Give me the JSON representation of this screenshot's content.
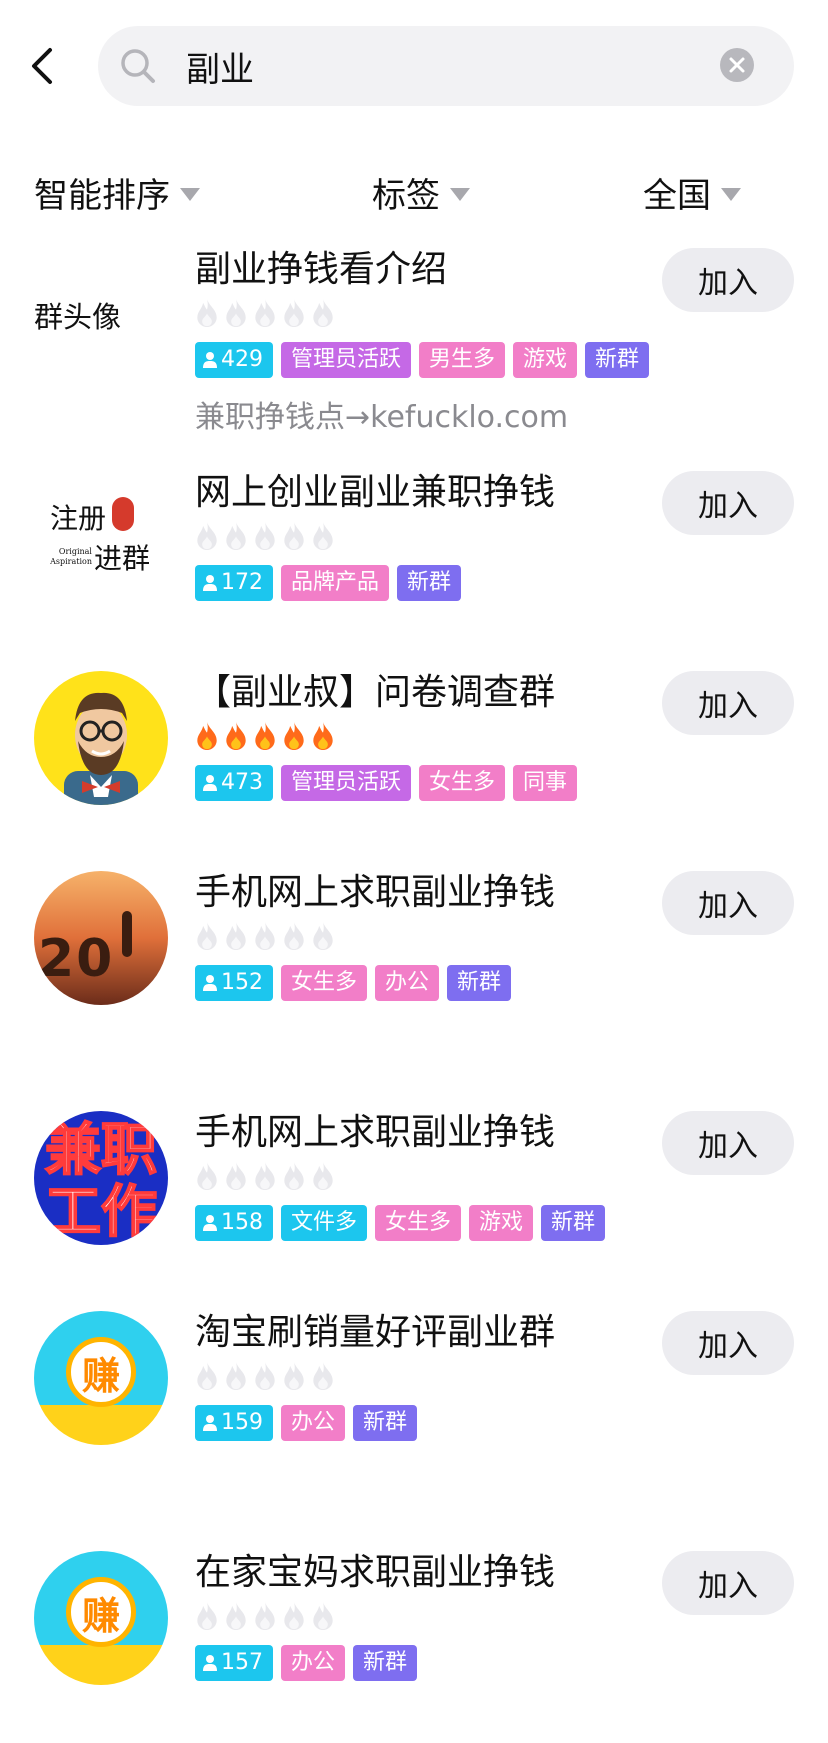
{
  "search": {
    "query": "副业"
  },
  "filters": [
    {
      "label": "智能排序"
    },
    {
      "label": "标签"
    },
    {
      "label": "全国"
    }
  ],
  "join_label": "加入",
  "groups": [
    {
      "name": "副业挣钱看介绍",
      "avatar_text": "群头像",
      "fire_level": 0,
      "members": "429",
      "tags": [
        {
          "text": "管理员活跃",
          "color": "#c569e6"
        },
        {
          "text": "男生多",
          "color": "#f27ec8"
        },
        {
          "text": "游戏",
          "color": "#f27ec8"
        },
        {
          "text": "新群",
          "color": "#7e6ef0"
        }
      ],
      "desc": "兼职挣钱点→kefucklo.com"
    },
    {
      "name": "网上创业副业兼职挣钱",
      "avatar_text_1": "注册",
      "avatar_text_2": "进群",
      "avatar_small_1": "Original",
      "avatar_small_2": "Aspiration",
      "fire_level": 0,
      "members": "172",
      "tags": [
        {
          "text": "品牌产品",
          "color": "#f27ec8"
        },
        {
          "text": "新群",
          "color": "#7e6ef0"
        }
      ]
    },
    {
      "name": "【副业叔】问卷调查群",
      "fire_level": 5,
      "members": "473",
      "tags": [
        {
          "text": "管理员活跃",
          "color": "#c569e6"
        },
        {
          "text": "女生多",
          "color": "#f27ec8"
        },
        {
          "text": "同事",
          "color": "#f27ec8"
        }
      ]
    },
    {
      "name": "手机网上求职副业挣钱",
      "avatar_text": "20",
      "fire_level": 0,
      "members": "152",
      "tags": [
        {
          "text": "女生多",
          "color": "#f27ec8"
        },
        {
          "text": "办公",
          "color": "#f27ec8"
        },
        {
          "text": "新群",
          "color": "#7e6ef0"
        }
      ]
    },
    {
      "name": "手机网上求职副业挣钱",
      "avatar_text_1": "兼职",
      "avatar_text_2": "工作",
      "fire_level": 0,
      "members": "158",
      "tags": [
        {
          "text": "文件多",
          "color": "#1cc6ee"
        },
        {
          "text": "女生多",
          "color": "#f27ec8"
        },
        {
          "text": "游戏",
          "color": "#f27ec8"
        },
        {
          "text": "新群",
          "color": "#7e6ef0"
        }
      ]
    },
    {
      "name": "淘宝刷销量好评副业群",
      "avatar_text": "赚",
      "fire_level": 0,
      "members": "159",
      "tags": [
        {
          "text": "办公",
          "color": "#f27ec8"
        },
        {
          "text": "新群",
          "color": "#7e6ef0"
        }
      ]
    },
    {
      "name": "在家宝妈求职副业挣钱",
      "avatar_text": "赚",
      "fire_level": 0,
      "members": "157",
      "tags": [
        {
          "text": "办公",
          "color": "#f27ec8"
        },
        {
          "text": "新群",
          "color": "#7e6ef0"
        }
      ]
    }
  ]
}
